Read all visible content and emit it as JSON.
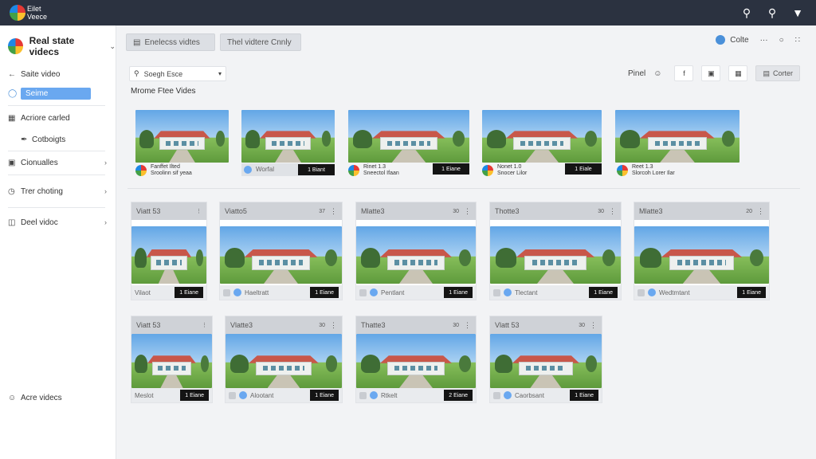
{
  "app": {
    "logo_text": "Eilet Veece"
  },
  "topbar": {
    "icons": [
      "search-icon",
      "magnifier-icon",
      "dropdown-icon"
    ]
  },
  "sidebar": {
    "title": "Real state videcs",
    "items": [
      {
        "label": "Saite video",
        "icon": "arrow-left-icon"
      },
      {
        "label": "Seime",
        "icon": "user-icon",
        "active": true
      },
      {
        "label": "Acriore carled",
        "icon": "grid-icon"
      },
      {
        "label": "Cotboigts",
        "icon": "brush-icon"
      },
      {
        "label": "Cionualles",
        "icon": "chat-icon"
      },
      {
        "label": "Trer choting",
        "icon": "clock-icon"
      },
      {
        "label": "Deel vidoc",
        "icon": "trash-icon"
      },
      {
        "label": "Acre videcs",
        "icon": "people-icon"
      }
    ]
  },
  "toolbar": {
    "btn1": "Enelecss vidtes",
    "btn2": "Thel vidtere Cnnly",
    "right_label": "Colte",
    "right_more": "···",
    "right_circle": "○"
  },
  "search": {
    "value": "Soegh Esce"
  },
  "actions": {
    "label": "Pinel",
    "button": "Corter"
  },
  "section": {
    "title": "Mrome Ftee Vides"
  },
  "featured": [
    {
      "line1": "Fanffet Ilted",
      "line2": "Sroolinn sif yeaa"
    },
    {
      "line1": "Worfal",
      "badge": "1 Biant"
    },
    {
      "line1": "Rinet 1.3",
      "line2": "Sneectol Ifaan",
      "badge": "1 Eiane"
    },
    {
      "line1": "Nonet 1.0",
      "line2": "Snocer Lilor",
      "badge": "1 Eiale"
    },
    {
      "line1": "Reet 1.3",
      "line2": "Slorcoh Lorer Ilar"
    }
  ],
  "grid": [
    {
      "title": "Viatt 53",
      "foot": "Vilaot",
      "badge": "1 Eiane"
    },
    {
      "title": "Viatto5",
      "foot": "Haeltratt",
      "badge": "1 Eiane"
    },
    {
      "title": "Mlatte3",
      "foot": "Pentlant",
      "badge": "1 Eiane"
    },
    {
      "title": "Thotte3",
      "foot": "Tlectant",
      "badge": "1 Eiane"
    },
    {
      "title": "Mlatte3",
      "foot": "Wedtmtant",
      "badge": "1 Eiane"
    },
    {
      "title": "Viatt 53",
      "foot": "Meslot",
      "badge": "1 Eiane"
    },
    {
      "title": "Vlatte3",
      "foot": "Alootant",
      "badge": "1 Eiane"
    },
    {
      "title": "Thatte3",
      "foot": "Rtkelt",
      "badge": "2 Eiane"
    },
    {
      "title": "Vlatt 53",
      "foot": "Caorbsant",
      "badge": "1 Eiane"
    }
  ]
}
